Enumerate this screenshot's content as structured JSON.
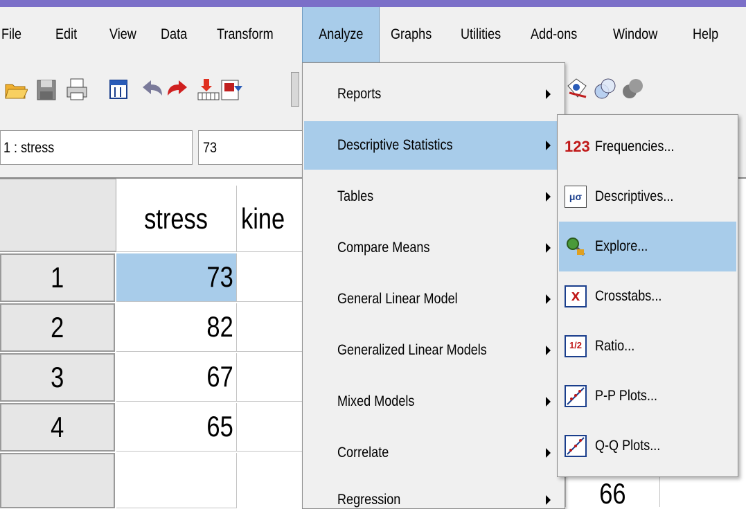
{
  "menubar": {
    "items": [
      {
        "label": "File",
        "mnemonic": "F"
      },
      {
        "label": "Edit",
        "mnemonic": "E"
      },
      {
        "label": "View",
        "mnemonic": "V"
      },
      {
        "label": "Data",
        "mnemonic": "D"
      },
      {
        "label": "Transform",
        "mnemonic": "T"
      },
      {
        "label": "Analyze",
        "mnemonic": "A"
      },
      {
        "label": "Graphs",
        "mnemonic": "G"
      },
      {
        "label": "Utilities",
        "mnemonic": "U"
      },
      {
        "label": "Add-ons",
        "mnemonic": "o"
      },
      {
        "label": "Window",
        "mnemonic": "W"
      },
      {
        "label": "Help",
        "mnemonic": "H"
      }
    ]
  },
  "cellbar": {
    "reference": "1 : stress",
    "value": "73"
  },
  "grid": {
    "columns": [
      "stress",
      "kine"
    ],
    "rows": [
      {
        "num": "1",
        "stress": "73"
      },
      {
        "num": "2",
        "stress": "82"
      },
      {
        "num": "3",
        "stress": "67"
      },
      {
        "num": "4",
        "stress": "65"
      }
    ],
    "partial_value": "66"
  },
  "analyze_menu": {
    "items": [
      {
        "label": "Reports",
        "has_submenu": true
      },
      {
        "label": "Descriptive Statistics",
        "has_submenu": true,
        "highlighted": true
      },
      {
        "label": "Tables",
        "has_submenu": true
      },
      {
        "label": "Compare Means",
        "has_submenu": true
      },
      {
        "label": "General Linear Model",
        "has_submenu": true
      },
      {
        "label": "Generalized Linear Models",
        "has_submenu": true
      },
      {
        "label": "Mixed Models",
        "has_submenu": true
      },
      {
        "label": "Correlate",
        "has_submenu": true
      },
      {
        "label": "Regression",
        "has_submenu": true
      }
    ]
  },
  "descriptive_submenu": {
    "items": [
      {
        "label": "Frequencies...",
        "icon": "frequencies-icon",
        "icon_text": "123"
      },
      {
        "label": "Descriptives...",
        "icon": "descriptives-icon",
        "icon_text": "μσ"
      },
      {
        "label": "Explore...",
        "icon": "explore-icon",
        "highlighted": true
      },
      {
        "label": "Crosstabs...",
        "icon": "crosstabs-icon",
        "icon_text": "x"
      },
      {
        "label": "Ratio...",
        "icon": "ratio-icon",
        "icon_text": "1/2"
      },
      {
        "label": "P-P Plots...",
        "icon": "pp-plots-icon"
      },
      {
        "label": "Q-Q Plots...",
        "icon": "qq-plots-icon"
      }
    ]
  },
  "colors": {
    "highlight": "#a8ccea",
    "menu_bg": "#f0f0f0",
    "title_stripe": "#7b6fc8"
  }
}
